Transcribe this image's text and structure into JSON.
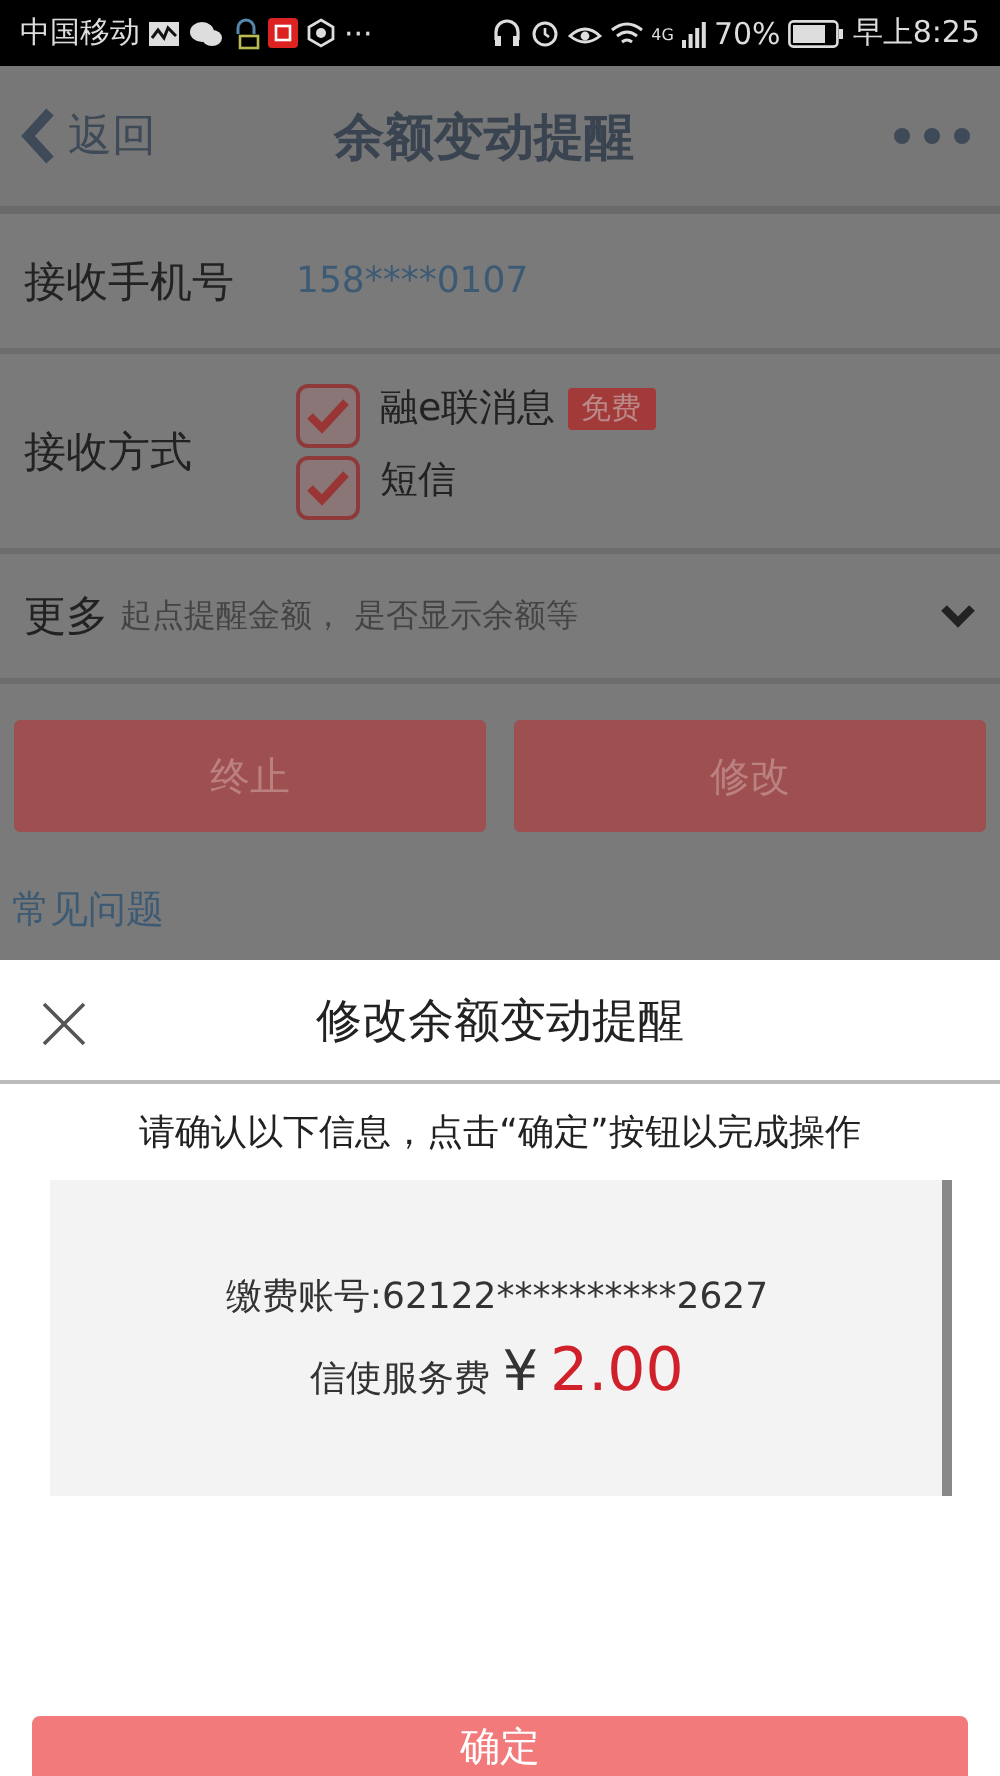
{
  "status_bar": {
    "carrier": "中国移动",
    "more": "···",
    "network": "4G",
    "battery": "70%",
    "time": "早上8:25"
  },
  "header": {
    "back": "返回",
    "title": "余额变动提醒"
  },
  "phone": {
    "label": "接收手机号",
    "value": "158****0107"
  },
  "receive": {
    "label": "接收方式",
    "options": [
      {
        "label": "融e联消息",
        "badge": "免费",
        "checked": true
      },
      {
        "label": "短信",
        "checked": true
      }
    ]
  },
  "more": {
    "label": "更多",
    "hint": "起点提醒金额， 是否显示余额等"
  },
  "buttons": [
    "终止",
    "修改"
  ],
  "faq": "常见问题",
  "sheet": {
    "title": "修改余额变动提醒",
    "instruction": "请确认以下信息，点击“确定”按钮以完成操作",
    "account": "缴费账号:62122**********2627",
    "fee_label": "信使服务费",
    "currency": "¥",
    "fee_amount": "2.00",
    "confirm": "确定"
  }
}
